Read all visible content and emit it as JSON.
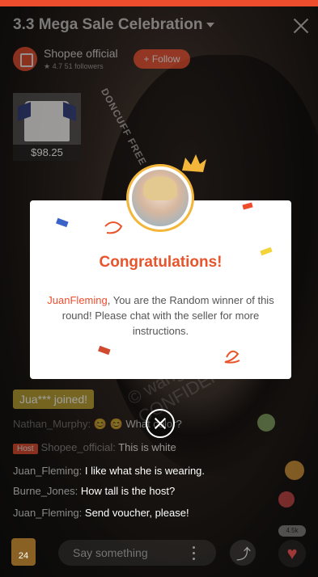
{
  "stream": {
    "title": "3.3 Mega Sale Celebration",
    "shop_name": "Shopee official",
    "shop_followers": "★ 4.7 51 followers",
    "follow_label": "+ Follow",
    "watermark_text": "© wangaw shopee.com CONFIDENTIAL",
    "stripe_text": "DONCUFF FREE"
  },
  "product": {
    "price": "$98.25"
  },
  "modal": {
    "title": "Congratulations!",
    "winner": "JuanFleming",
    "message": ", You are the Random winner of this round! Please chat with the seller for more instructions."
  },
  "chat": {
    "joined": "Jua*** joined!",
    "lines": [
      {
        "name": "Nathan_Murphy:",
        "msg": "😊 😊 What color?"
      },
      {
        "host": "Host",
        "name": "Shopee_official:",
        "msg": "This is white"
      },
      {
        "name": "Juan_Fleming:",
        "msg": "I like what she is wearing."
      },
      {
        "name": "Burne_Jones:",
        "msg": "How tall is the host?"
      },
      {
        "name": "Juan_Fleming:",
        "msg": "Send voucher, please!"
      }
    ]
  },
  "bottom": {
    "bag_count": "24",
    "say_placeholder": "Say something",
    "like_count": "4.5k"
  },
  "icons": {
    "close": "close-icon",
    "dismiss": "close-circle-icon",
    "bag": "shopping-bag-icon",
    "share": "share-icon",
    "heart": "heart-icon",
    "more": "more-vertical-icon",
    "crown": "crown-icon"
  },
  "colors": {
    "brand": "#ee4d2d",
    "gold": "#f3b63a",
    "title": "#e8542b"
  }
}
